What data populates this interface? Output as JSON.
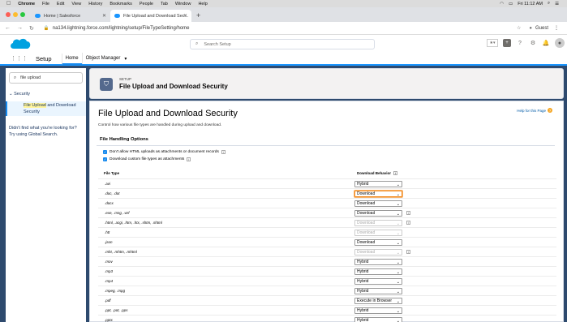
{
  "os_menu": {
    "apple": "",
    "app": "Chrome",
    "items": [
      "File",
      "Edit",
      "View",
      "History",
      "Bookmarks",
      "People",
      "Tab",
      "Window",
      "Help"
    ],
    "clock": "Fri 11:12 AM"
  },
  "browser": {
    "tabs": [
      {
        "label": "Home | Salesforce"
      },
      {
        "label": "File Upload and Download Sec..."
      }
    ],
    "new_tab": "+",
    "url": "na134.lightning.force.com/lightning/setup/FileTypeSetting/home",
    "profile": "Guest"
  },
  "header": {
    "search_placeholder": "Search Setup"
  },
  "app_nav": {
    "app_name": "Setup",
    "tabs": [
      "Home",
      "Object Manager"
    ]
  },
  "left": {
    "search_value": "file upload",
    "section": "Security",
    "item_highlight": "File Upload",
    "item_rest": " and Download Security",
    "note": "Didn't find what you're looking for? Try using Global Search."
  },
  "page_header": {
    "eyebrow": "SETUP",
    "title": "File Upload and Download Security"
  },
  "content": {
    "title": "File Upload and Download Security",
    "help": "Help for this Page",
    "description": "Control how various file types are handled during upload and download.",
    "section_title": "File Handling Options",
    "checkbox1": "Don't allow HTML uploads as attachments or document records",
    "checkbox2": "Download custom file types as attachments",
    "col_file_type": "File Type",
    "col_behavior": "Download Behavior",
    "rows": [
      {
        "type": ".avi",
        "behavior": "Hybrid",
        "state": "normal"
      },
      {
        "type": ".doc, .dot",
        "behavior": "Download",
        "state": "focus"
      },
      {
        "type": ".docx",
        "behavior": "Download",
        "state": "normal"
      },
      {
        "type": ".exe, .msg, .wrf",
        "behavior": "Download",
        "state": "info"
      },
      {
        "type": ".html, .acgi, .htm, .htx, .shtm, .shtml",
        "behavior": "Download",
        "state": "disabled-info"
      },
      {
        "type": ".htt",
        "behavior": "Download",
        "state": "disabled"
      },
      {
        "type": ".json",
        "behavior": "Download",
        "state": "normal"
      },
      {
        "type": ".mht, .mhtm, .mhtml",
        "behavior": "Download",
        "state": "disabled-info"
      },
      {
        "type": ".mov",
        "behavior": "Hybrid",
        "state": "normal"
      },
      {
        "type": ".mp3",
        "behavior": "Hybrid",
        "state": "normal"
      },
      {
        "type": ".mp4",
        "behavior": "Hybrid",
        "state": "normal"
      },
      {
        "type": ".mpeg, .mpg",
        "behavior": "Hybrid",
        "state": "normal"
      },
      {
        "type": ".pdf",
        "behavior": "Execute in Browser",
        "state": "normal"
      },
      {
        "type": ".ppt, .pot, .pps",
        "behavior": "Hybrid",
        "state": "normal"
      },
      {
        "type": ".pptx",
        "behavior": "Hybrid",
        "state": "normal"
      }
    ]
  }
}
